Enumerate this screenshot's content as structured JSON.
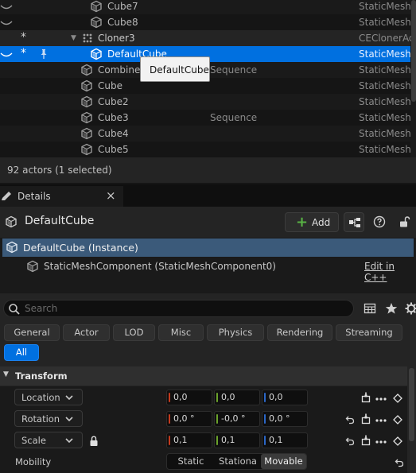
{
  "outliner": {
    "rows": [
      {
        "label": "Cube7",
        "type": "StaticMesh"
      },
      {
        "label": "Cube8",
        "type": "StaticMesh"
      },
      {
        "label": "Cloner3",
        "type": "CEClonerAc"
      },
      {
        "label": "DefaultCube",
        "type": "StaticMesh"
      },
      {
        "label": "Combined",
        "type": "StaticMesh",
        "extra": "Sequence"
      },
      {
        "label": "Cube",
        "type": "StaticMesh"
      },
      {
        "label": "Cube2",
        "type": "StaticMesh"
      },
      {
        "label": "Cube3",
        "type": "StaticMesh",
        "extra": "Sequence"
      },
      {
        "label": "Cube4",
        "type": "StaticMesh"
      },
      {
        "label": "Cube5",
        "type": "StaticMesh"
      }
    ],
    "star": "*",
    "tooltip": "DefaultCube",
    "status": "92 actors (1 selected)"
  },
  "details": {
    "tab_label": "Details",
    "close_glyph": "×",
    "actor_name": "DefaultCube",
    "add_label": "Add",
    "instance_label": "DefaultCube (Instance)",
    "component_label": "StaticMeshComponent (StaticMeshComponent0)",
    "edit_cpp_label": "Edit in C++",
    "search_placeholder": "Search",
    "filters": [
      "General",
      "Actor",
      "LOD",
      "Misc",
      "Physics",
      "Rendering",
      "Streaming",
      "All"
    ],
    "section_title": "Transform",
    "location_label": "Location",
    "rotation_label": "Rotation",
    "scale_label": "Scale",
    "mobility_label": "Mobility",
    "location": [
      "0,0",
      "0,0",
      "0,0"
    ],
    "rotation": [
      "0,0 °",
      "-0,0 °",
      "0,0 °"
    ],
    "scale": [
      "0,1",
      "0,1",
      "0,1"
    ],
    "mobility_options": [
      "Static",
      "Stationa",
      "Movable"
    ],
    "mobility_selected": "Movable"
  },
  "colors": {
    "selection": "#0070e0",
    "instance_row": "#3b5a7a",
    "axis_x": "#c43a1d",
    "axis_y": "#6ba22b",
    "axis_z": "#2b67c7"
  }
}
